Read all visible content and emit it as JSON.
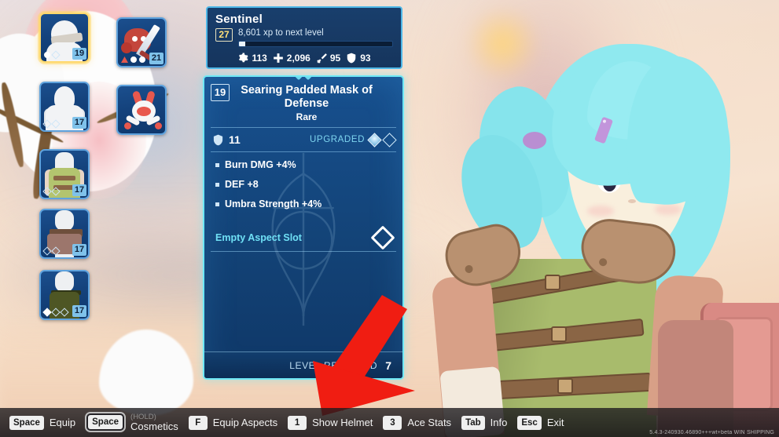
{
  "character_panel": {
    "name": "Sentinel",
    "level": "27",
    "xp_text": "8,601 xp to next level",
    "xp_percent": 4,
    "stats": [
      {
        "icon": "gear-icon",
        "value": "113"
      },
      {
        "icon": "health-cross-icon",
        "value": "2,096"
      },
      {
        "icon": "sword-icon",
        "value": "95"
      },
      {
        "icon": "shield-icon",
        "value": "93"
      }
    ]
  },
  "item_card": {
    "level": "19",
    "title": "Searing Padded Mask of Defense",
    "rarity": "Rare",
    "defense_value": "11",
    "upgraded_label": "UPGRADED",
    "upgrade_gems": [
      "filled",
      "empty"
    ],
    "perks": [
      "Burn DMG +4%",
      "DEF +8",
      "Umbra Strength +4%"
    ],
    "aspect_slot_label": "Empty Aspect Slot",
    "level_required_label": "LEVEL REQUIRED",
    "level_required_value": "7"
  },
  "inventory": {
    "slots": [
      {
        "name": "helmet-slot",
        "level": "19",
        "selected": true,
        "gems": [
          "round",
          "diamond"
        ]
      },
      {
        "name": "weapon-slot",
        "level": "21",
        "selected": false,
        "gems": [
          "triangle",
          "round",
          "round"
        ]
      },
      {
        "name": "shirt-slot",
        "level": "17",
        "selected": false,
        "gems": [
          "diamond",
          "diamond"
        ]
      },
      {
        "name": "pet-slot",
        "level": "",
        "selected": false,
        "gems": []
      },
      {
        "name": "vest-slot",
        "level": "17",
        "selected": false,
        "gems": [
          "diamond",
          "diamond"
        ]
      },
      {
        "name": "skirt-slot",
        "level": "17",
        "selected": false,
        "gems": [
          "diamond",
          "diamond"
        ]
      },
      {
        "name": "pants-slot",
        "level": "17",
        "selected": false,
        "gems": [
          "filled",
          "diamond",
          "diamond"
        ]
      }
    ]
  },
  "bottom_bar": {
    "hints": [
      {
        "key": "Space",
        "label": "Equip",
        "hold": false,
        "hold_tag": ""
      },
      {
        "key": "Space",
        "label": "Cosmetics",
        "hold": true,
        "hold_tag": "(HOLD)"
      },
      {
        "key": "F",
        "label": "Equip Aspects",
        "hold": false,
        "hold_tag": ""
      },
      {
        "key": "1",
        "label": "Show Helmet",
        "hold": false,
        "hold_tag": ""
      },
      {
        "key": "3",
        "label": "Ace Stats",
        "hold": false,
        "hold_tag": ""
      },
      {
        "key": "Tab",
        "label": "Info",
        "hold": false,
        "hold_tag": ""
      },
      {
        "key": "Esc",
        "label": "Exit",
        "hold": false,
        "hold_tag": ""
      }
    ],
    "version": "5.4.3-240930.46890+++wt+beta WIN SHIPPING"
  },
  "colors": {
    "card_border": "#6fe8f5",
    "panel_border": "#4fb8e8",
    "accent_cyan": "#6fe0f5",
    "level_yellow": "#ffe07a",
    "selected_gold": "#ffd86b",
    "arrow_red": "#f01d12"
  }
}
